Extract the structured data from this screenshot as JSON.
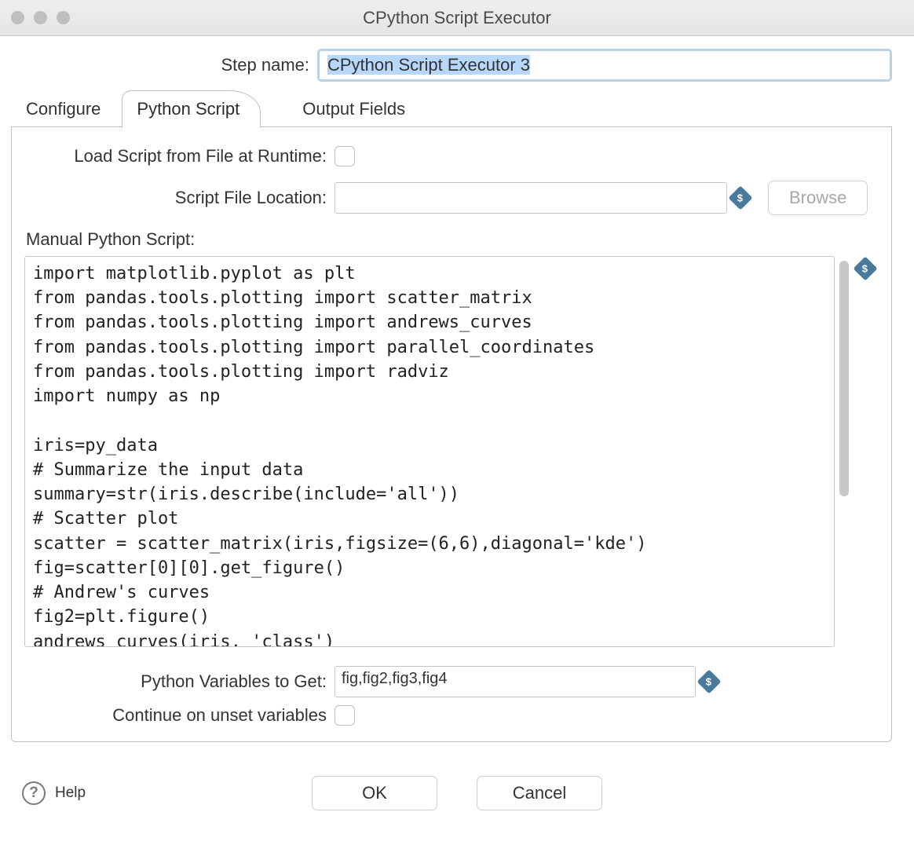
{
  "window": {
    "title": "CPython Script Executor"
  },
  "form": {
    "step_name_label": "Step name:",
    "step_name_value": "CPython Script Executor 3"
  },
  "tabs": {
    "configure": "Configure",
    "python_script": "Python Script",
    "output_fields": "Output Fields",
    "active": "python_script"
  },
  "labels": {
    "load_from_file": "Load Script from File at Runtime:",
    "script_file_location": "Script File Location:",
    "browse": "Browse",
    "manual_script": "Manual Python Script:",
    "vars_to_get": "Python Variables to Get:",
    "continue_unset": "Continue on unset variables"
  },
  "fields": {
    "load_from_file_checked": false,
    "script_file_location_value": "",
    "python_vars_to_get": "fig,fig2,fig3,fig4",
    "continue_unset_checked": false
  },
  "script": "import matplotlib.pyplot as plt\nfrom pandas.tools.plotting import scatter_matrix\nfrom pandas.tools.plotting import andrews_curves\nfrom pandas.tools.plotting import parallel_coordinates\nfrom pandas.tools.plotting import radviz\nimport numpy as np\n\niris=py_data\n# Summarize the input data\nsummary=str(iris.describe(include='all'))\n# Scatter plot\nscatter = scatter_matrix(iris,figsize=(6,6),diagonal='kde')\nfig=scatter[0][0].get_figure()\n# Andrew's curves\nfig2=plt.figure()\nandrews_curves(iris, 'class')",
  "buttons": {
    "help": "Help",
    "ok": "OK",
    "cancel": "Cancel"
  }
}
